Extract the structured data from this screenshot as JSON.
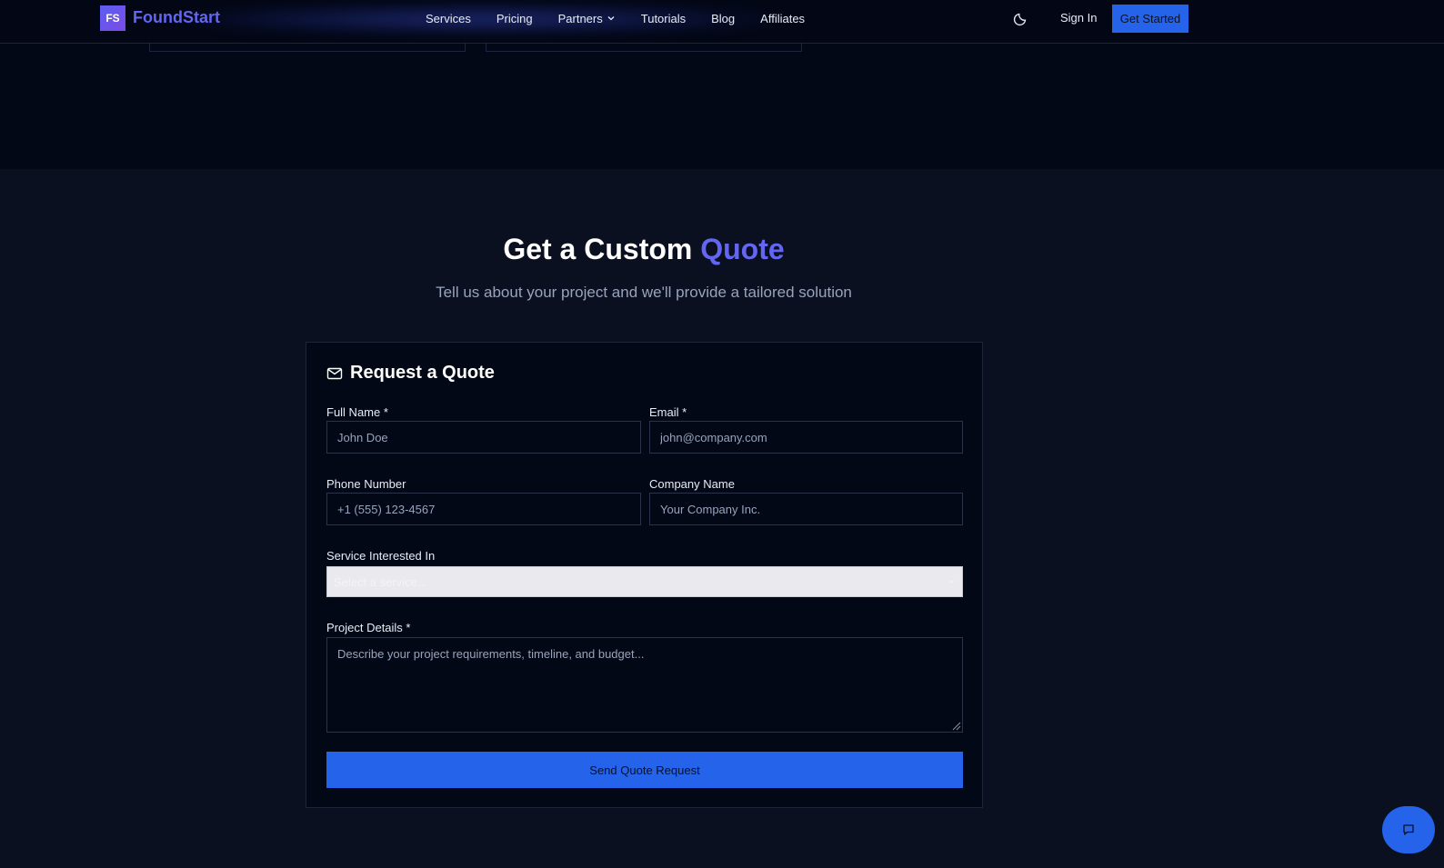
{
  "brand": {
    "logo_initials": "FS",
    "name": "FoundStart"
  },
  "nav": {
    "items": [
      {
        "label": "Services"
      },
      {
        "label": "Pricing"
      },
      {
        "label": "Partners",
        "has_dropdown": true
      },
      {
        "label": "Tutorials"
      },
      {
        "label": "Blog"
      },
      {
        "label": "Affiliates"
      }
    ],
    "theme_toggle_icon": "moon-icon",
    "signin_label": "Sign In",
    "cta_label": "Get Started"
  },
  "quote_section": {
    "title_main": "Get a Custom ",
    "title_accent": "Quote",
    "subtitle": "Tell us about your project and we'll provide a tailored solution"
  },
  "form": {
    "heading": "Request a Quote",
    "heading_icon": "mail-icon",
    "full_name": {
      "label": "Full Name *",
      "placeholder": "John Doe",
      "value": ""
    },
    "email": {
      "label": "Email *",
      "placeholder": "john@company.com",
      "value": ""
    },
    "phone": {
      "label": "Phone Number",
      "placeholder": "+1 (555) 123-4567",
      "value": ""
    },
    "company": {
      "label": "Company Name",
      "placeholder": "Your Company Inc.",
      "value": ""
    },
    "service": {
      "label": "Service Interested In",
      "selected": "Select a service..."
    },
    "details": {
      "label": "Project Details *",
      "placeholder": "Describe your project requirements, timeline, and budget...",
      "value": ""
    },
    "submit_label": "Send Quote Request"
  },
  "chat": {
    "icon": "chat-icon"
  },
  "colors": {
    "accent": "#6366f1",
    "primary_button": "#2563eb",
    "page_bg": "#0a101f",
    "card_bg": "#030816"
  }
}
